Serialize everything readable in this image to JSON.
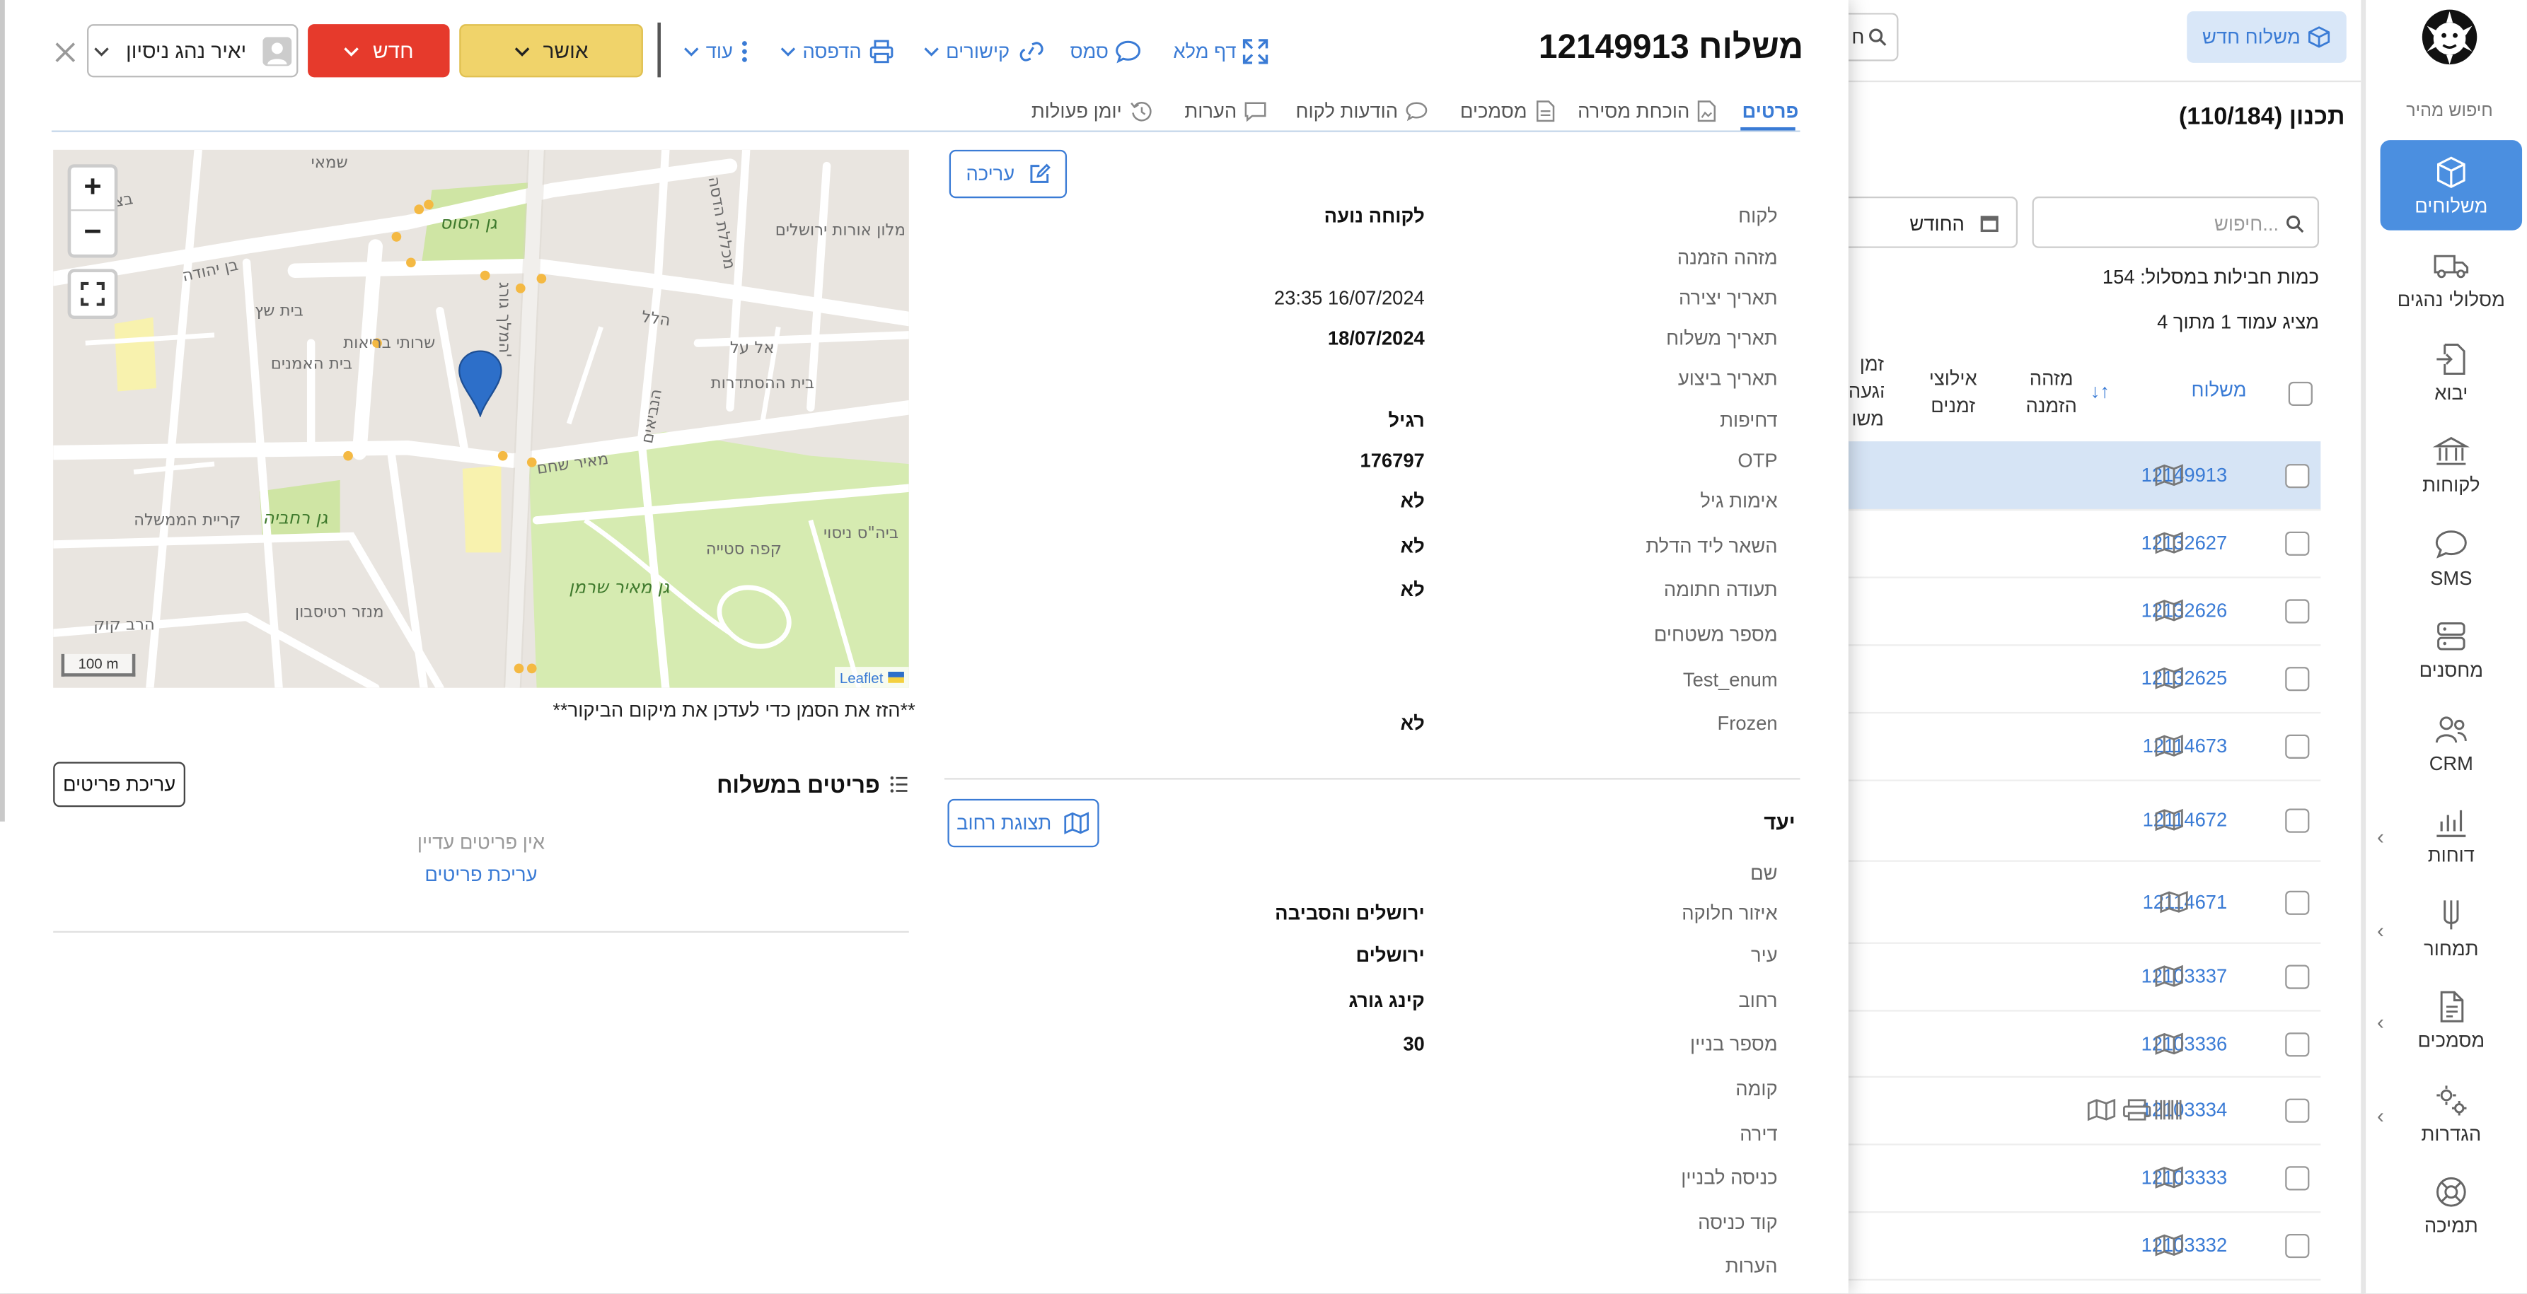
{
  "app": {
    "quick_search": "חיפוש מהיר",
    "new_shipment_btn": "משלוח חדש",
    "plan_title": "תכנון (110/184)",
    "search_placeholder": "חיפוש...",
    "header_search_fragment": "ח",
    "period_value": "החודש",
    "package_count": "כמות חבילות במסלול: 154",
    "page_info": "מציג עמוד 1 מתוך 4"
  },
  "sidebar": {
    "items": [
      {
        "label": "משלוחים",
        "icon": "cube-icon"
      },
      {
        "label": "מסלולי נהגים",
        "icon": "truck-icon"
      },
      {
        "label": "יבוא",
        "icon": "import-icon"
      },
      {
        "label": "לקוחות",
        "icon": "bank-icon"
      },
      {
        "label": "SMS",
        "icon": "chat-icon"
      },
      {
        "label": "מחסנים",
        "icon": "server-icon"
      },
      {
        "label": "CRM",
        "icon": "users-icon"
      },
      {
        "label": "דוחות",
        "icon": "report-icon"
      },
      {
        "label": "תמחור",
        "icon": "pricing-icon"
      },
      {
        "label": "מסמכים",
        "icon": "document-icon"
      },
      {
        "label": "הגדרות",
        "icon": "settings-icon"
      },
      {
        "label": "תמיכה",
        "icon": "support-icon"
      }
    ]
  },
  "list": {
    "columns": {
      "shipment": "משלוח",
      "order_id_1": "מזהה",
      "order_id_2": "הזמנה",
      "time_const_1": "אילוצי",
      "time_const_2": "זמנים",
      "arrival_1": "זמן",
      "arrival_2": "הגעה",
      "arrival_3": "משו"
    },
    "rows": [
      "12149913",
      "12132627",
      "12132626",
      "12132625",
      "12114673",
      "12114672",
      "12114671",
      "12103337",
      "12103336",
      "12103334",
      "12103333",
      "12103332"
    ]
  },
  "modal": {
    "title": "משלוח 12149913",
    "header_links": {
      "fullpage": "דף מלא",
      "sms": "סמס",
      "links": "קישורים",
      "print": "הדפסה",
      "more": "עוד"
    },
    "status_approved": "אושר",
    "status_new": "חדש",
    "driver": "יאיר נהג ניסיון",
    "tabs": [
      "פרטים",
      "הוכחת מסירה",
      "מסמכים",
      "הודעות לקוח",
      "הערות",
      "יומן פעולות"
    ],
    "edit_btn": "עריכה",
    "details": [
      {
        "label": "לקוח",
        "value": "לקוחה נועה"
      },
      {
        "label": "מזהה הזמנה",
        "value": ""
      },
      {
        "label": "תאריך יצירה",
        "value": "23:35 16/07/2024"
      },
      {
        "label": "תאריך משלוח",
        "value": "18/07/2024"
      },
      {
        "label": "תאריך ביצוע",
        "value": ""
      },
      {
        "label": "דחיפות",
        "value": "רגיל"
      },
      {
        "label": "OTP",
        "value": "176797"
      },
      {
        "label": "אימות גיל",
        "value": "לא"
      },
      {
        "label": "השאר ליד הדלת",
        "value": "לא"
      },
      {
        "label": "תעודה חתומה",
        "value": "לא"
      },
      {
        "label": "מספר משטחים",
        "value": ""
      },
      {
        "label": "Test_enum",
        "value": ""
      },
      {
        "label": "Frozen",
        "value": "לא"
      }
    ],
    "destination_title": "יעד",
    "street_view_btn": "תצוגת רחוב",
    "destination": [
      {
        "label": "שם",
        "value": ""
      },
      {
        "label": "איזור חלוקה",
        "value": "ירושלים והסביבה"
      },
      {
        "label": "עיר",
        "value": "ירושלים"
      },
      {
        "label": "רחוב",
        "value": "קינג גורג"
      },
      {
        "label": "מספר בניין",
        "value": "30"
      },
      {
        "label": "קומה",
        "value": ""
      },
      {
        "label": "דירה",
        "value": ""
      },
      {
        "label": "כניסה לבניין",
        "value": ""
      },
      {
        "label": "קוד כניסה",
        "value": ""
      },
      {
        "label": "הערות",
        "value": ""
      }
    ],
    "map": {
      "hint": "**הזז את הסמן כדי לעדכן את מיקום הביקור**",
      "zoom_in": "+",
      "zoom_out": "−",
      "scale": "100 m",
      "attribution": "Leaflet",
      "labels": [
        "גן הסוס",
        "גן רחביה",
        "גן מאיר שרמן",
        "בצלאל",
        "שמאי",
        "בן יהודה",
        "הלל",
        "המלך גורג'",
        "הנביאים",
        "מאיר שחם",
        "בית שץ",
        "בית האמנים",
        "שרותי בריאות",
        "מכללת הדסה",
        "מלון אורות ירושלים",
        "אל על",
        "בית ההסתדרות",
        "קריית הממשלה",
        "ביה\"ס ניסוי",
        "מנזר רטיסבון",
        "הרב קוק",
        "קפה סטייה"
      ]
    },
    "items_title": "פריטים במשלוח",
    "edit_items_btn": "עריכת פריטים",
    "no_items": "אין פריטים עדיין",
    "edit_items_link": "עריכת פריטים"
  }
}
